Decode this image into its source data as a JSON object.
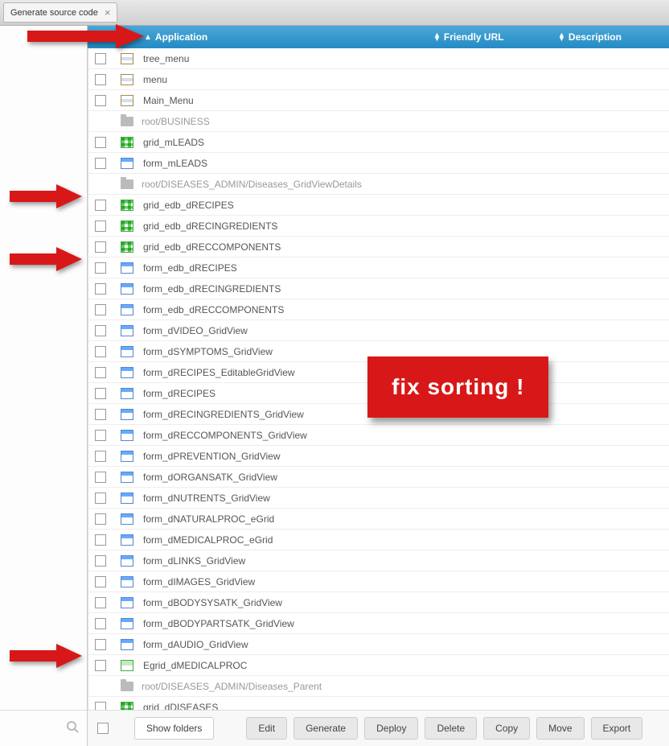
{
  "tab": {
    "title": "Generate source code"
  },
  "header": {
    "application": "Application",
    "friendly_url": "Friendly URL",
    "description": "Description"
  },
  "rows": [
    {
      "type": "menu",
      "label": "tree_menu"
    },
    {
      "type": "menu",
      "label": "menu"
    },
    {
      "type": "menu",
      "label": "Main_Menu"
    },
    {
      "type": "folder",
      "label": "root/BUSINESS"
    },
    {
      "type": "grid",
      "label": "grid_mLEADS"
    },
    {
      "type": "form",
      "label": "form_mLEADS"
    },
    {
      "type": "folder",
      "label": "root/DISEASES_ADMIN/Diseases_GridViewDetails"
    },
    {
      "type": "grid",
      "label": "grid_edb_dRECIPES"
    },
    {
      "type": "grid",
      "label": "grid_edb_dRECINGREDIENTS"
    },
    {
      "type": "grid",
      "label": "grid_edb_dRECCOMPONENTS"
    },
    {
      "type": "form",
      "label": "form_edb_dRECIPES"
    },
    {
      "type": "form",
      "label": "form_edb_dRECINGREDIENTS"
    },
    {
      "type": "form",
      "label": "form_edb_dRECCOMPONENTS"
    },
    {
      "type": "form",
      "label": "form_dVIDEO_GridView"
    },
    {
      "type": "form",
      "label": "form_dSYMPTOMS_GridView"
    },
    {
      "type": "form",
      "label": "form_dRECIPES_EditableGridView"
    },
    {
      "type": "form",
      "label": "form_dRECIPES"
    },
    {
      "type": "form",
      "label": "form_dRECINGREDIENTS_GridView"
    },
    {
      "type": "form",
      "label": "form_dRECCOMPONENTS_GridView"
    },
    {
      "type": "form",
      "label": "form_dPREVENTION_GridView"
    },
    {
      "type": "form",
      "label": "form_dORGANSATK_GridView"
    },
    {
      "type": "form",
      "label": "form_dNUTRENTS_GridView"
    },
    {
      "type": "form",
      "label": "form_dNATURALPROC_eGrid"
    },
    {
      "type": "form",
      "label": "form_dMEDICALPROC_eGrid"
    },
    {
      "type": "form",
      "label": "form_dLINKS_GridView"
    },
    {
      "type": "form",
      "label": "form_dIMAGES_GridView"
    },
    {
      "type": "form",
      "label": "form_dBODYSYSATK_GridView"
    },
    {
      "type": "form",
      "label": "form_dBODYPARTSATK_GridView"
    },
    {
      "type": "form",
      "label": "form_dAUDIO_GridView"
    },
    {
      "type": "egrid",
      "label": "Egrid_dMEDICALPROC"
    },
    {
      "type": "folder",
      "label": "root/DISEASES_ADMIN/Diseases_Parent"
    },
    {
      "type": "grid",
      "label": "grid_dDISEASES"
    }
  ],
  "buttons": {
    "show_folders": "Show folders",
    "edit": "Edit",
    "generate": "Generate",
    "deploy": "Deploy",
    "delete": "Delete",
    "copy": "Copy",
    "move": "Move",
    "export": "Export"
  },
  "callout": "fix sorting !"
}
